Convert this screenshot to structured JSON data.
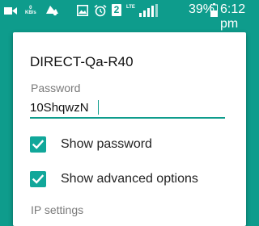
{
  "status_bar": {
    "network_speed": "KB/s",
    "sim_slot": "2",
    "network_type": "LTE",
    "battery_percent": "39%",
    "time": "6:12 pm",
    "icons": [
      "video-icon",
      "network-speed-icon",
      "notification-icon",
      "gallery-icon",
      "alarm-icon",
      "sim-icon",
      "signal-icon",
      "battery-icon"
    ]
  },
  "dialog": {
    "network_name": "DIRECT-Qa-R40",
    "password_label": "Password",
    "password_value": "10ShqwzN",
    "show_password_label": "Show password",
    "show_password_checked": true,
    "show_advanced_label": "Show advanced options",
    "show_advanced_checked": true,
    "ip_settings_label": "IP settings"
  },
  "colors": {
    "accent": "#0e9c8c",
    "checkbox": "#11a79a",
    "dialog_bg": "#ffffff"
  }
}
